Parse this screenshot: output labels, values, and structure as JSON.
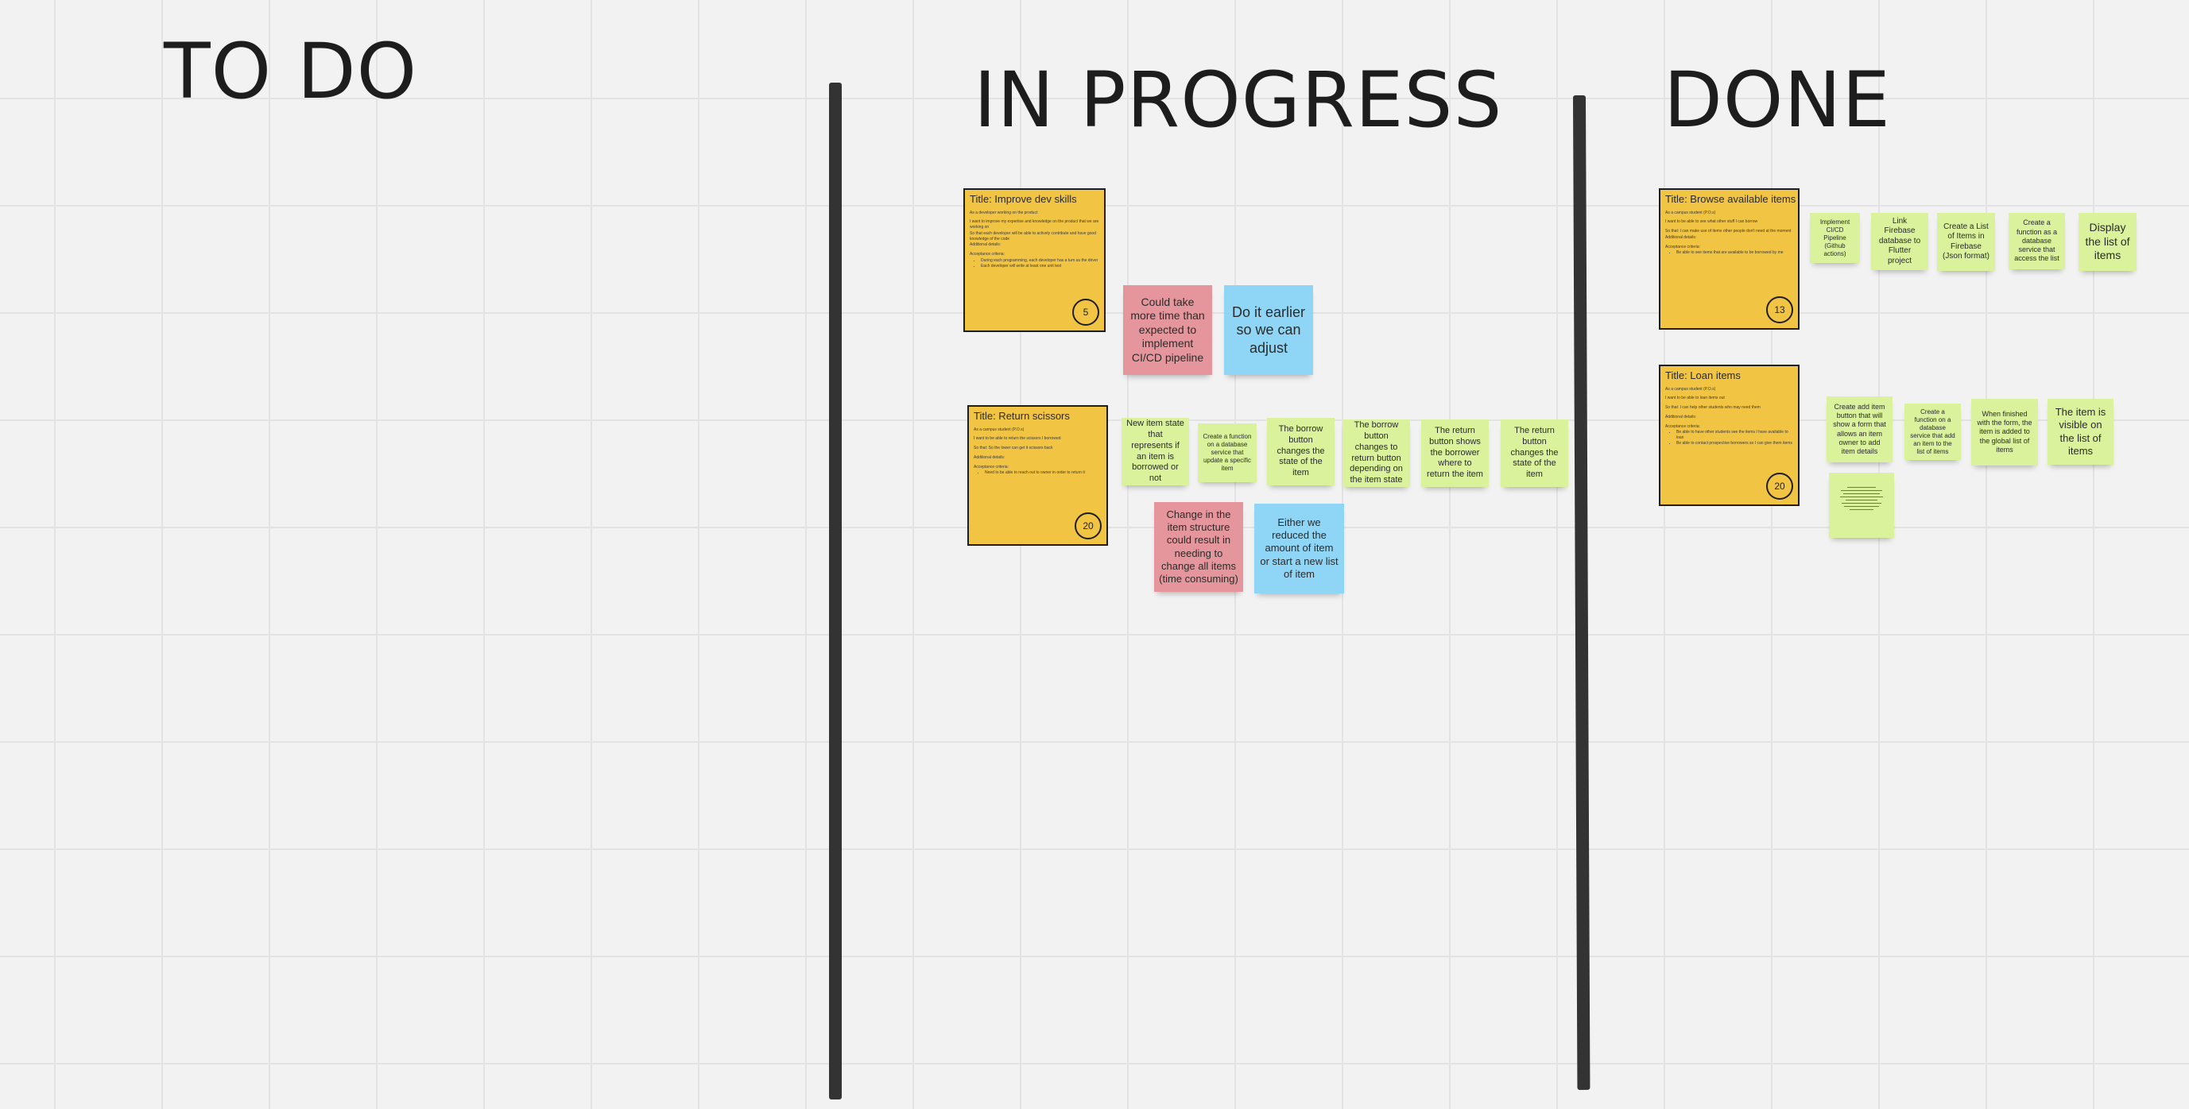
{
  "columns": {
    "todo": "TO DO",
    "in_progress": "IN PROGRESS",
    "done": "DONE"
  },
  "stories": {
    "improve_dev": {
      "title": "Title: Improve dev skills",
      "lines": [
        "As a developer working on the product",
        "I want to improve my expertise and knowledge on the product that we are working on",
        "So that each developer will be able to actively contribute and have good knowledge of the code",
        "Additional details:",
        "Acceptance criteria:"
      ],
      "bullets": [
        "During each programming, each developer has a turn as the driver",
        "Each developer will write at least one unit test"
      ],
      "points": "5"
    },
    "return_scissors": {
      "title": "Title: Return scissors",
      "lines": [
        "As a campus student (P.O.s)",
        "I want to be able to return the scissors I borrowed",
        "So that: So the lower can get it scissors back",
        "Additional details:",
        "Acceptance criteria:"
      ],
      "bullets": [
        "Need to be able to reach out to owner in order to return it"
      ],
      "points": "20"
    },
    "browse_items": {
      "title": "Title: Browse available items",
      "lines": [
        "As a campus student (P.O.s)",
        "I want to be able to see what other stuff I can borrow",
        "So that: I can make use of items other people don't need at the moment",
        "Additional details:",
        "Acceptance criteria:"
      ],
      "bullets": [
        "Be able to see items that are available to be borrowed by me"
      ],
      "points": "13"
    },
    "loan_items": {
      "title": "Title: Loan items",
      "lines": [
        "As a campus student (P.O.s)",
        "I want to be able to loan items out",
        "So that: I can help other students who may need them",
        "Additional details:",
        "Acceptance criteria:"
      ],
      "bullets": [
        "Be able to have other students see the items I have available to loan",
        "Be able to contact prospective borrowers so I can give them items"
      ],
      "points": "20"
    }
  },
  "stickies": {
    "ci_cd_risk": "Could take more time than expected to implement CI/CD pipeline",
    "do_earlier": "Do it earlier so we can adjust",
    "new_item_state": "New item state that represents if an item is borrowed or not",
    "create_db_fn_update": "Create a function on a database service that update a specific item",
    "borrow_button_state": "The borrow button changes the state of the item",
    "borrow_button_changes": "The borrow button changes to return button depending on the item state",
    "return_button_shows": "The return button shows the borrower where to return the item",
    "return_button_state": "The return button changes the state of the item",
    "item_structure_risk": "Change in the item structure could result in needing to change all items (time consuming)",
    "reduce_items": "Either we reduced the amount of item or start a new list of item",
    "ci_cd_pipeline": "Implement CI/CD Pipeline (Github actions)",
    "link_firebase": "Link Firebase database to Flutter project",
    "create_list_firebase": "Create a List of Items in Firebase (Json format)",
    "create_db_fn_access": "Create a function as a database service that access the list",
    "display_list": "Display the list of items",
    "create_add_item": "Create add item button that will show a form that allows an item owner to add item details",
    "create_db_fn_add": "Create a function on a database service that add an item to the list of items",
    "when_finished": "When finished with the form, the item is added to the global list of items",
    "item_visible": "The item is visible on the list of items"
  },
  "colors": {
    "story": "#f2c443",
    "task": "#d9f29b",
    "risk": "#e5969d",
    "mitigation": "#8fd5f6",
    "divider": "#333333"
  }
}
